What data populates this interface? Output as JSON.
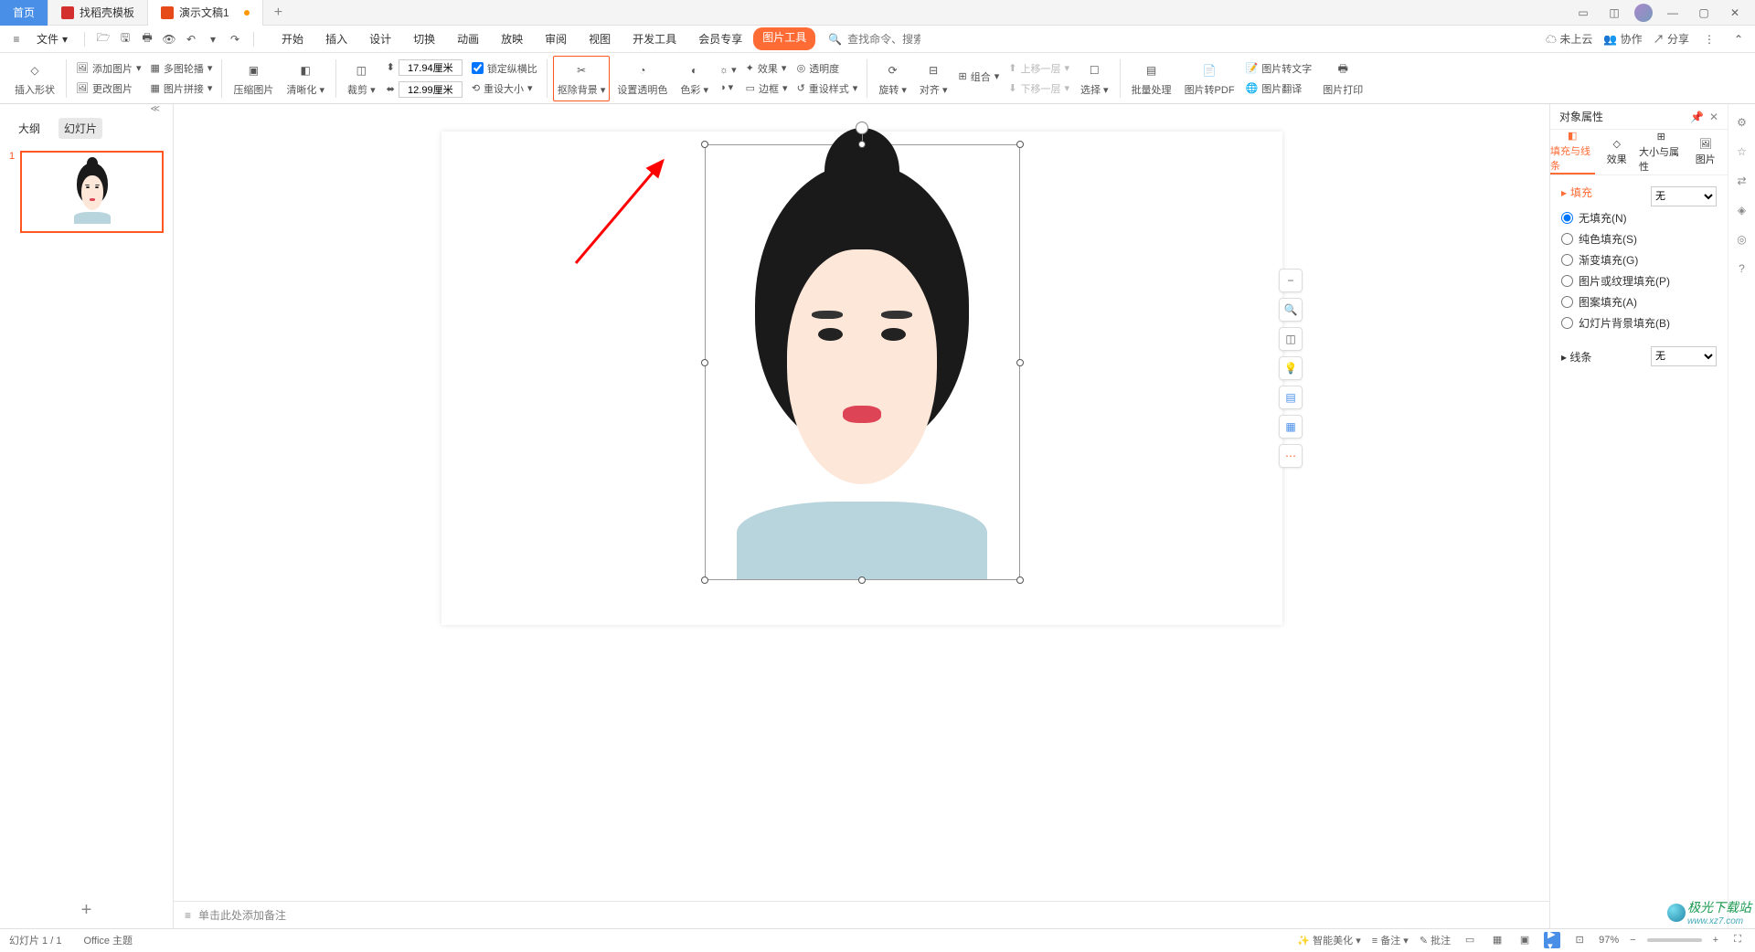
{
  "tabs": {
    "home": "首页",
    "template": "找稻壳模板",
    "doc": "演示文稿1"
  },
  "menu": {
    "file": "文件",
    "items": [
      "开始",
      "插入",
      "设计",
      "切换",
      "动画",
      "放映",
      "审阅",
      "视图",
      "开发工具",
      "会员专享"
    ],
    "picture_tools": "图片工具",
    "search_cmd": "查找命令、搜索模板",
    "not_uploaded": "未上云",
    "collab": "协作",
    "share": "分享"
  },
  "ribbon": {
    "insert_shape": "插入形状",
    "r1": [
      "添加图片",
      "更改图片"
    ],
    "r2": [
      "多图轮播",
      "图片拼接"
    ],
    "compress": "压缩图片",
    "sharpen": "清晰化",
    "crop": "裁剪",
    "width": "17.94厘米",
    "height": "12.99厘米",
    "lock_ratio": "锁定纵横比",
    "reset_size": "重设大小",
    "remove_bg": "抠除背景",
    "set_trans": "设置透明色",
    "color": "色彩",
    "effect": "效果",
    "border": "边框",
    "trans": "透明度",
    "reset_style": "重设样式",
    "rotate": "旋转",
    "align": "对齐",
    "group": "组合",
    "up": "上移一层",
    "down": "下移一层",
    "select": "选择",
    "batch": "批量处理",
    "to_pdf": "图片转PDF",
    "to_text": "图片转文字",
    "translate": "图片翻译",
    "print": "图片打印"
  },
  "nav": {
    "outline": "大纲",
    "slides": "幻灯片"
  },
  "notes": "单击此处添加备注",
  "props": {
    "title": "对象属性",
    "tabs": [
      "填充与线条",
      "效果",
      "大小与属性",
      "图片"
    ],
    "fill": "填充",
    "options": [
      "无填充(N)",
      "纯色填充(S)",
      "渐变填充(G)",
      "图片或纹理填充(P)",
      "图案填充(A)",
      "幻灯片背景填充(B)"
    ],
    "line": "线条",
    "none": "无"
  },
  "status": {
    "slide": "幻灯片 1 / 1",
    "theme": "Office 主题",
    "beautify": "智能美化",
    "notes": "备注",
    "comments": "批注",
    "zoom": "97%"
  },
  "wm": {
    "name": "极光下载站",
    "url": "www.xz7.com"
  }
}
